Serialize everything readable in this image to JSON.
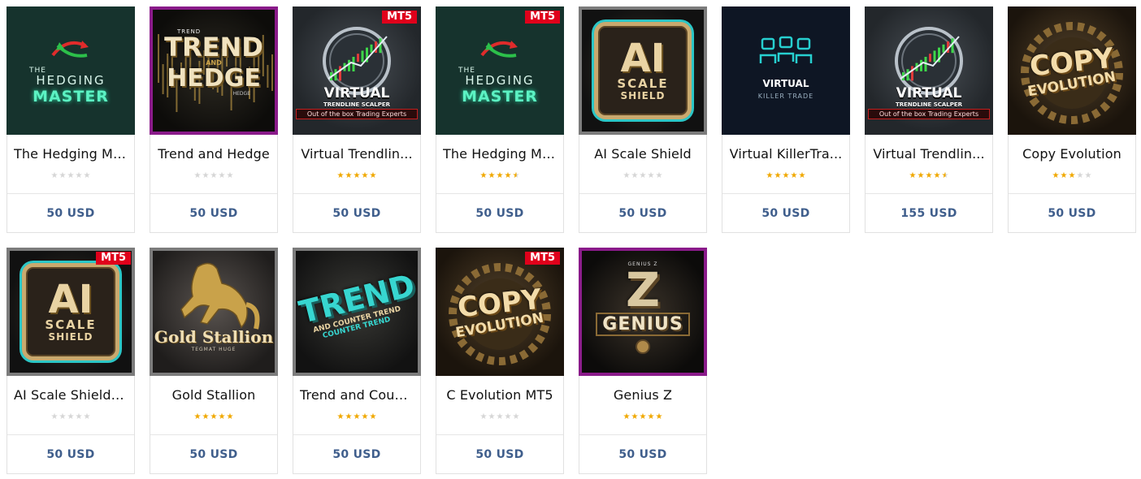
{
  "products": [
    {
      "name": "The Hedging Ma...",
      "price": "50 USD",
      "rating": 0,
      "theme": "hedge",
      "badge": "",
      "thumb_lines": [
        "THE",
        "HEDGING",
        "MASTER"
      ]
    },
    {
      "name": "Trend and Hedge",
      "price": "50 USD",
      "rating": 0,
      "theme": "trend",
      "badge": "",
      "frame": "purple",
      "thumb_lines": [
        "TREND",
        "AND",
        "HEDGE",
        "TREND",
        "HEDGE"
      ]
    },
    {
      "name": "Virtual Trendlin...",
      "price": "50 USD",
      "rating": 5,
      "theme": "virt",
      "badge": "MT5",
      "thumb_lines": [
        "VIRTUAL",
        "TRENDLINE SCALPER",
        "Out of the box Trading Experts"
      ]
    },
    {
      "name": "The Hedging Ma...",
      "price": "50 USD",
      "rating": 4.5,
      "theme": "hedge",
      "badge": "MT5",
      "thumb_lines": [
        "THE",
        "HEDGING",
        "MASTER"
      ]
    },
    {
      "name": "AI Scale Shield",
      "price": "50 USD",
      "rating": 0,
      "theme": "ai",
      "badge": "",
      "frame": "gray",
      "thumb_lines": [
        "AI",
        "SCALE",
        "SHIELD"
      ]
    },
    {
      "name": "Virtual KillerTra...",
      "price": "50 USD",
      "rating": 5,
      "theme": "killer",
      "badge": "",
      "thumb_lines": [
        "VIRTUAL",
        "KILLER TRADE"
      ]
    },
    {
      "name": "Virtual Trendlin...",
      "price": "155 USD",
      "rating": 4.5,
      "theme": "virt",
      "badge": "",
      "thumb_lines": [
        "VIRTUAL",
        "TRENDLINE SCALPER",
        "Out of the box Trading Experts"
      ]
    },
    {
      "name": "Copy Evolution",
      "price": "50 USD",
      "rating": 3,
      "theme": "copy",
      "badge": "",
      "thumb_lines": [
        "COPY",
        "EVOLUTION"
      ]
    },
    {
      "name": "AI Scale Shield ...",
      "price": "50 USD",
      "rating": 0,
      "theme": "ai",
      "badge": "MT5",
      "frame": "gray",
      "thumb_lines": [
        "AI",
        "SCALE",
        "SHIELD"
      ]
    },
    {
      "name": "Gold Stallion",
      "price": "50 USD",
      "rating": 5,
      "theme": "gold",
      "badge": "",
      "frame": "gray",
      "thumb_lines": [
        "Gold Stallion",
        "TEGMAT HUGE"
      ]
    },
    {
      "name": "Trend and Coun...",
      "price": "50 USD",
      "rating": 5,
      "theme": "tct",
      "badge": "",
      "frame": "gray",
      "thumb_lines": [
        "TREND",
        "AND COUNTER TREND",
        "COUNTER TREND"
      ]
    },
    {
      "name": "C Evolution MT5",
      "price": "50 USD",
      "rating": 0,
      "theme": "copy",
      "badge": "MT5",
      "thumb_lines": [
        "COPY",
        "EVOLUTION"
      ]
    },
    {
      "name": "Genius Z",
      "price": "50 USD",
      "rating": 5,
      "theme": "genius",
      "badge": "",
      "frame": "purple",
      "thumb_lines": [
        "GENIUS Z",
        "Z",
        "GENIUS"
      ]
    }
  ],
  "colors": {
    "price": "#3f5e8c",
    "star_on": "#f0a800",
    "star_off": "#d6d6d6",
    "badge": "#e0001b",
    "frame_purple": "#8a1b8a",
    "frame_gray": "#7c7c7c"
  },
  "icons": {
    "star": "star-icon",
    "arrows": "hedge-arrows-icon",
    "chart": "candlestick-chart-icon",
    "robot": "robot-heads-icon",
    "horse": "stallion-icon",
    "gear": "gear-icon"
  }
}
